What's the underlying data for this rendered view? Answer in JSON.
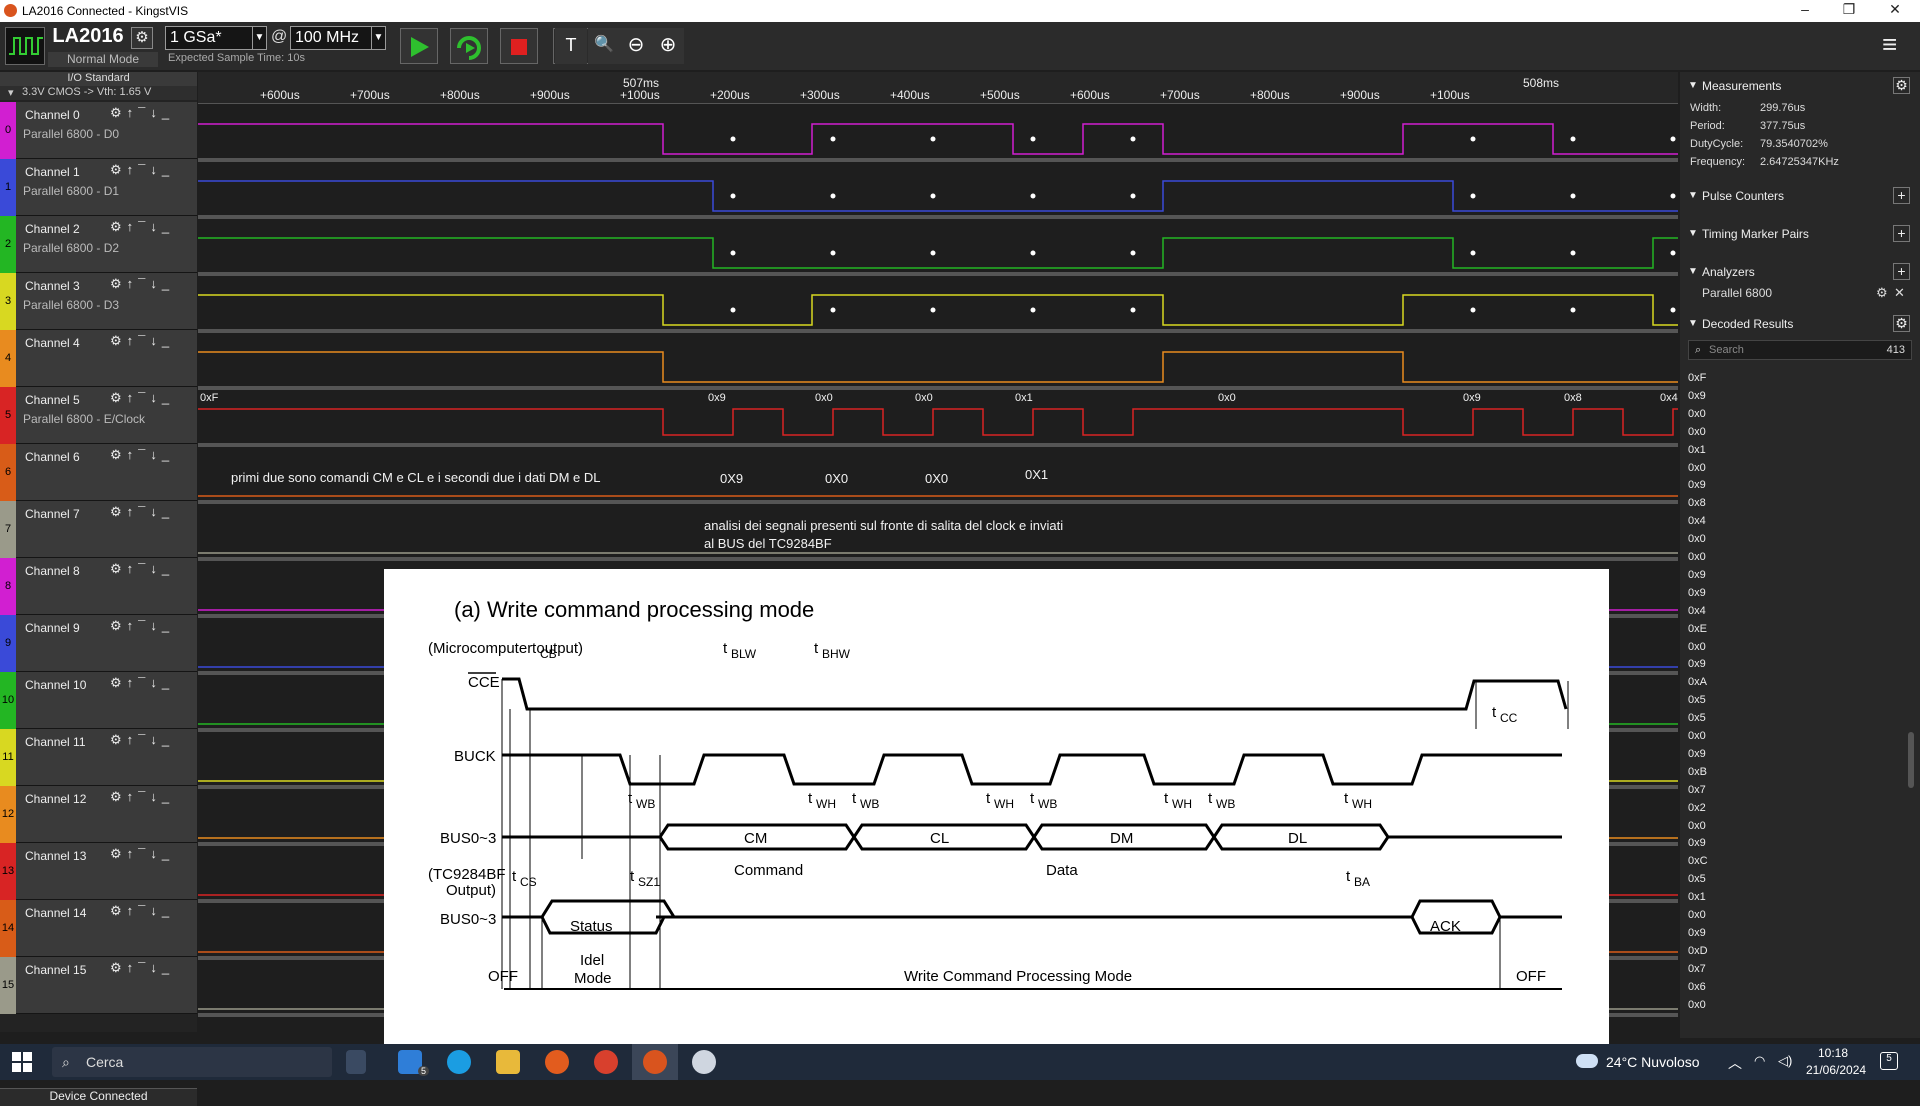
{
  "window": {
    "title": "LA2016 Connected - KingstVIS"
  },
  "toolbar": {
    "device_name": "LA2016",
    "device_mode": "Normal Mode",
    "sample_rate": "1 GSa*",
    "at": "@",
    "frequency": "100 MHz",
    "expected_time": "Expected Sample Time: 10s"
  },
  "sidebar": {
    "io_standard": "I/O Standard",
    "io_value": "3.3V CMOS -> Vth: 1.65 V",
    "status": "Device Connected",
    "channels": [
      {
        "num": "0",
        "name": "Channel 0",
        "sub": "Parallel 6800 - D0",
        "color": "#d11fd1"
      },
      {
        "num": "1",
        "name": "Channel 1",
        "sub": "Parallel 6800 - D1",
        "color": "#3a4ad8"
      },
      {
        "num": "2",
        "name": "Channel 2",
        "sub": "Parallel 6800 - D2",
        "color": "#23b623"
      },
      {
        "num": "3",
        "name": "Channel 3",
        "sub": "Parallel 6800 - D3",
        "color": "#d8d821"
      },
      {
        "num": "4",
        "name": "Channel 4",
        "sub": "",
        "color": "#e88b1f"
      },
      {
        "num": "5",
        "name": "Channel 5",
        "sub": "Parallel 6800 - E/Clock",
        "color": "#d82424"
      },
      {
        "num": "6",
        "name": "Channel 6",
        "sub": "",
        "color": "#d85c18"
      },
      {
        "num": "7",
        "name": "Channel 7",
        "sub": "",
        "color": "#9a9a8a"
      },
      {
        "num": "8",
        "name": "Channel 8",
        "sub": "",
        "color": "#d11fd1"
      },
      {
        "num": "9",
        "name": "Channel 9",
        "sub": "",
        "color": "#3a4ad8"
      },
      {
        "num": "10",
        "name": "Channel 10",
        "sub": "",
        "color": "#23b623"
      },
      {
        "num": "11",
        "name": "Channel 11",
        "sub": "",
        "color": "#d8d821"
      },
      {
        "num": "12",
        "name": "Channel 12",
        "sub": "",
        "color": "#e88b1f"
      },
      {
        "num": "13",
        "name": "Channel 13",
        "sub": "",
        "color": "#d82424"
      },
      {
        "num": "14",
        "name": "Channel 14",
        "sub": "",
        "color": "#d85c18"
      },
      {
        "num": "15",
        "name": "Channel 15",
        "sub": "",
        "color": "#9a9a8a"
      }
    ]
  },
  "ruler": {
    "marker1": "507ms",
    "marker2": "508ms",
    "ticks": [
      "+600us",
      "+700us",
      "+800us",
      "+900us",
      "+100us",
      "+200us",
      "+300us",
      "+400us",
      "+500us",
      "+600us",
      "+700us",
      "+800us",
      "+900us",
      "+100us"
    ]
  },
  "decode_labels": [
    "0xF",
    "0x9",
    "0x0",
    "0x0",
    "0x1",
    "0x0",
    "0x9",
    "0x8",
    "0x4"
  ],
  "annotations": {
    "ch6_note": "primi due sono comandi CM e CL e i secondi due i dati DM e DL",
    "ch6_vals": [
      "0X9",
      "0X0",
      "0X0",
      "0X1"
    ],
    "ch7_note1": "analisi dei segnali presenti sul fronte di salita del clock e inviati",
    "ch7_note2": "al BUS del TC9284BF"
  },
  "diagram": {
    "title": "(a) Write command processing mode",
    "micro_output": "(Microcomputer output)",
    "cce": "CCE",
    "buck": "BUCK",
    "bus1": "BUS0~3",
    "bus2": "BUS0~3",
    "tc_out1": "(TC9284BF",
    "tc_out2": "Output)",
    "tcb": "CB",
    "tblw": "BLW",
    "tbhw": "BHW",
    "tcc": "CC",
    "twb": "WB",
    "twh": "WH",
    "tcs": "CS",
    "tsz1": "SZ1",
    "tba": "BA",
    "t": "t",
    "cm": "CM",
    "cl": "CL",
    "dm": "DM",
    "dl": "DL",
    "command": "Command",
    "data": "Data",
    "status": "Status",
    "ack": "ACK",
    "off": "OFF",
    "idel": "Idel",
    "mode": "Mode",
    "wcpm": "Write Command Processing Mode"
  },
  "rpanel": {
    "measurements": "Measurements",
    "width_l": "Width:",
    "width_v": "299.76us",
    "period_l": "Period:",
    "period_v": "377.75us",
    "duty_l": "DutyCycle:",
    "duty_v": "79.3540702%",
    "freq_l": "Frequency:",
    "freq_v": "2.64725347KHz",
    "pulse": "Pulse Counters",
    "timing": "Timing Marker Pairs",
    "analyzers": "Analyzers",
    "analyzer_item": "Parallel 6800",
    "decoded": "Decoded Results",
    "search_ph": "Search",
    "count": "413",
    "results": [
      "0xF",
      "0x9",
      "0x0",
      "0x0",
      "0x1",
      "0x0",
      "0x9",
      "0x8",
      "0x4",
      "0x0",
      "0x0",
      "0x9",
      "0x9",
      "0x4",
      "0xE",
      "0x0",
      "0x9",
      "0xA",
      "0x5",
      "0x5",
      "0x0",
      "0x9",
      "0xB",
      "0x7",
      "0x2",
      "0x0",
      "0x9",
      "0xC",
      "0x5",
      "0x1",
      "0x0",
      "0x9",
      "0xD",
      "0x7",
      "0x6",
      "0x0"
    ]
  },
  "taskbar": {
    "search": "Cerca",
    "weather": "24°C  Nuvoloso",
    "time": "10:18",
    "date": "21/06/2024",
    "mail_badge": "5",
    "notif": "5"
  }
}
